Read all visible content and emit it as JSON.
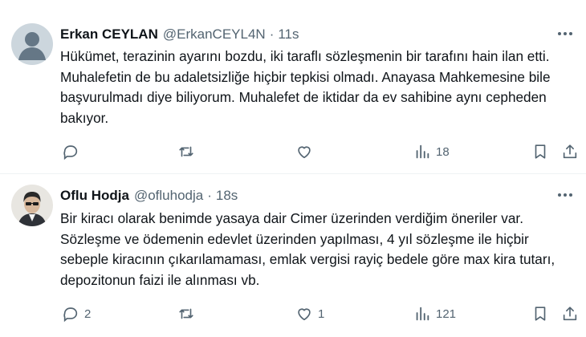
{
  "tweets": [
    {
      "name": "Erkan CEYLAN",
      "handle": "@ErkanCEYL4N",
      "separator": "·",
      "time": "11s",
      "text": "Hükümet, terazinin ayarını bozdu, iki taraflı sözleşmenin bir tarafını hain ilan etti. Muhalefetin de bu adaletsizliğe hiçbir tepkisi olmadı. Anayasa Mahkemesine bile başvurulmadı diye biliyorum. Muhalefet de iktidar da ev sahibine aynı cepheden bakıyor.",
      "counts": {
        "replies": "",
        "retweets": "",
        "likes": "",
        "views": "18"
      }
    },
    {
      "name": "Oflu Hodja",
      "handle": "@ofluhodja",
      "separator": "·",
      "time": "18s",
      "text": "Bir kiracı olarak benimde yasaya dair Cimer üzerinden verdiğim öneriler var. Sözleşme ve ödemenin edevlet üzerinden yapılması, 4 yıl sözleşme ile hiçbir sebeple kiracının çıkarılamaması, emlak vergisi rayiç bedele göre max kira tutarı, depozitonun faizi ile alınması vb.",
      "counts": {
        "replies": "2",
        "retweets": "",
        "likes": "1",
        "views": "121"
      }
    }
  ],
  "icons": [
    "more-icon",
    "reply-icon",
    "retweet-icon",
    "like-icon",
    "views-icon",
    "bookmark-icon",
    "share-icon"
  ],
  "colors": {
    "text": "#0f1419",
    "secondary": "#536471",
    "divider": "#eff3f4"
  }
}
